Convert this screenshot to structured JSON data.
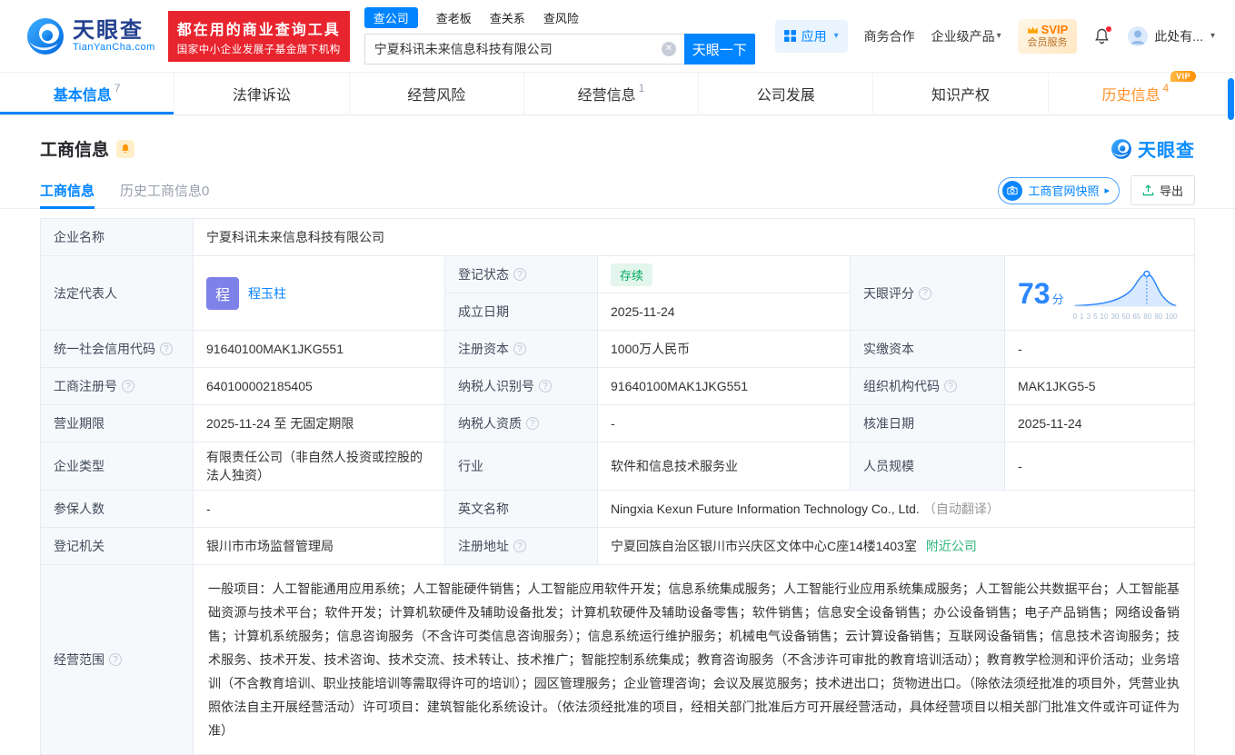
{
  "icons": {
    "help": "?",
    "caret_down": "▾",
    "chevron_right": "▸",
    "clear": "✕"
  },
  "header": {
    "logo": {
      "brand": "天眼查",
      "domain": "TianYanCha.com"
    },
    "slogan": {
      "line1": "都在用的商业查询工具",
      "line2": "国家中小企业发展子基金旗下机构"
    },
    "search": {
      "tabs": [
        {
          "label": "查公司"
        },
        {
          "label": "查老板"
        },
        {
          "label": "查关系"
        },
        {
          "label": "查风险"
        }
      ],
      "value": "宁夏科讯未来信息科技有限公司",
      "button": "天眼一下"
    },
    "right": {
      "apps": "应用",
      "cooperation": "商务合作",
      "enterprise": "企业级产品",
      "svip_top": "SVIP",
      "svip_bottom": "会员服务",
      "user": "此处有..."
    }
  },
  "nav_tabs": [
    {
      "label": "基本信息",
      "count": "7"
    },
    {
      "label": "法律诉讼",
      "count": ""
    },
    {
      "label": "经营风险",
      "count": ""
    },
    {
      "label": "经营信息",
      "count": "1"
    },
    {
      "label": "公司发展",
      "count": ""
    },
    {
      "label": "知识产权",
      "count": ""
    },
    {
      "label": "历史信息",
      "count": "4",
      "badge": "VIP"
    }
  ],
  "section": {
    "title": "工商信息",
    "brand": "天眼查",
    "subtabs": [
      {
        "label": "工商信息"
      },
      {
        "label": "历史工商信息0"
      }
    ],
    "snapshot": "工商官网快照",
    "export": "导出"
  },
  "info": {
    "company_name": {
      "label": "企业名称",
      "value": "宁夏科讯未来信息科技有限公司"
    },
    "legal_rep": {
      "label": "法定代表人",
      "avatar": "程",
      "name": "程玉柱"
    },
    "reg_status": {
      "label": "登记状态",
      "value": "存续"
    },
    "establish_date": {
      "label": "成立日期",
      "value": "2025-11-24"
    },
    "score": {
      "label": "天眼评分",
      "value": "73",
      "unit": "分",
      "axis_labels": [
        "0",
        "1",
        "3",
        "5",
        "10",
        "30",
        "50",
        "65",
        "80",
        "90",
        "100"
      ]
    },
    "credit_code": {
      "label": "统一社会信用代码",
      "value": "91640100MAK1JKG551"
    },
    "reg_capital": {
      "label": "注册资本",
      "value": "1000万人民币"
    },
    "paid_capital": {
      "label": "实缴资本",
      "value": "-"
    },
    "reg_number": {
      "label": "工商注册号",
      "value": "640100002185405"
    },
    "taxpayer_id": {
      "label": "纳税人识别号",
      "value": "91640100MAK1JKG551"
    },
    "org_code": {
      "label": "组织机构代码",
      "value": "MAK1JKG5-5"
    },
    "business_term": {
      "label": "营业期限",
      "value": "2025-11-24 至 无固定期限"
    },
    "taxpayer_quality": {
      "label": "纳税人资质",
      "value": "-"
    },
    "approval_date": {
      "label": "核准日期",
      "value": "2025-11-24"
    },
    "company_type": {
      "label": "企业类型",
      "value": "有限责任公司（非自然人投资或控股的法人独资）"
    },
    "industry": {
      "label": "行业",
      "value": "软件和信息技术服务业"
    },
    "staff_size": {
      "label": "人员规模",
      "value": "-"
    },
    "insured_count": {
      "label": "参保人数",
      "value": "-"
    },
    "english_name": {
      "label": "英文名称",
      "value": "Ningxia Kexun Future Information Technology Co., Ltd.",
      "note": "（自动翻译）"
    },
    "reg_authority": {
      "label": "登记机关",
      "value": "银川市市场监督管理局"
    },
    "reg_address": {
      "label": "注册地址",
      "value": "宁夏回族自治区银川市兴庆区文体中心C座14楼1403室",
      "link": "附近公司"
    },
    "business_scope": {
      "label": "经营范围",
      "value": "一般项目：人工智能通用应用系统；人工智能硬件销售；人工智能应用软件开发；信息系统集成服务；人工智能行业应用系统集成服务；人工智能公共数据平台；人工智能基础资源与技术平台；软件开发；计算机软硬件及辅助设备批发；计算机软硬件及辅助设备零售；软件销售；信息安全设备销售；办公设备销售；电子产品销售；网络设备销售；计算机系统服务；信息咨询服务（不含许可类信息咨询服务）；信息系统运行维护服务；机械电气设备销售；云计算设备销售；互联网设备销售；信息技术咨询服务；技术服务、技术开发、技术咨询、技术交流、技术转让、技术推广；智能控制系统集成；教育咨询服务（不含涉许可审批的教育培训活动）；教育教学检测和评价活动；业务培训（不含教育培训、职业技能培训等需取得许可的培训）；园区管理服务；企业管理咨询；会议及展览服务；技术进出口；货物进出口。（除依法须经批准的项目外，凭营业执照依法自主开展经营活动）许可项目：建筑智能化系统设计。（依法须经批准的项目，经相关部门批准后方可开展经营活动，具体经营项目以相关部门批准文件或许可证件为准）"
    }
  },
  "colors": {
    "brand_blue": "#0084ff",
    "badge_red": "#e8242e",
    "status_green": "#00ab5e",
    "history_orange": "#ff9125",
    "score_blue": "#2b86ff"
  }
}
